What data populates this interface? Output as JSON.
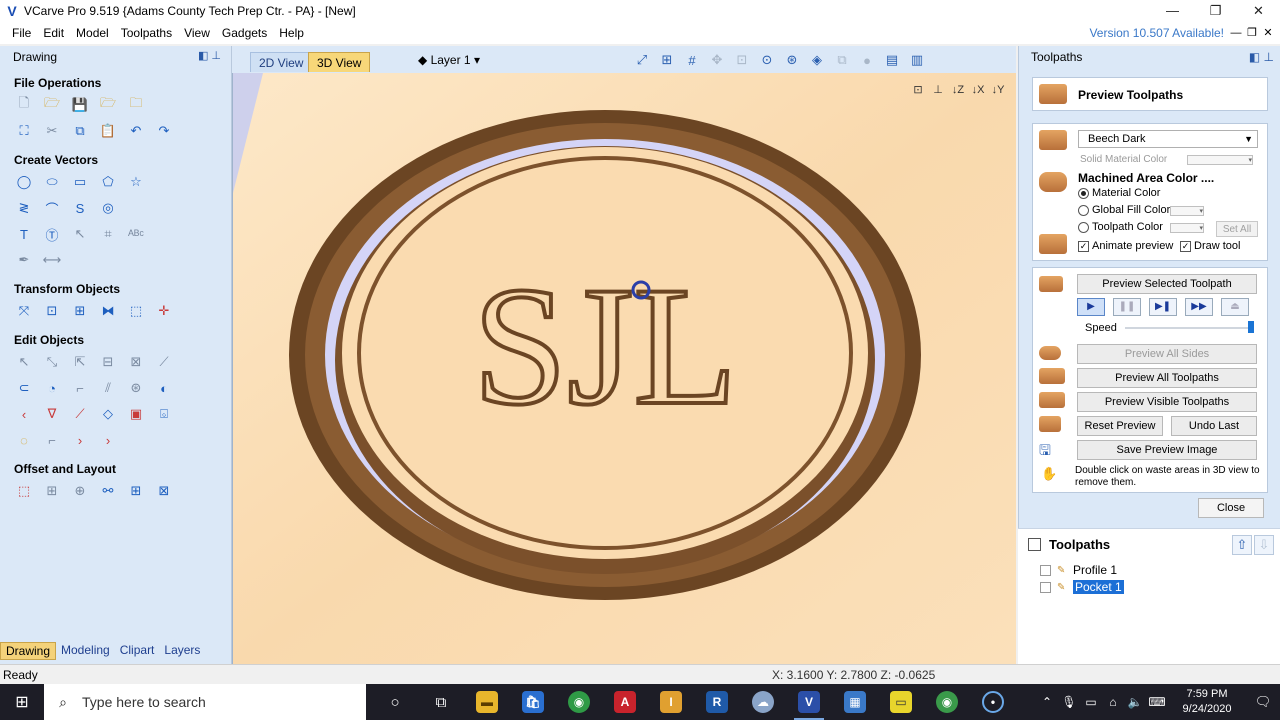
{
  "window": {
    "title": "VCarve Pro 9.519 {Adams County Tech Prep Ctr. - PA} - [New]",
    "controls": [
      "—",
      "❐",
      "✕"
    ]
  },
  "menu": {
    "items": [
      "File",
      "Edit",
      "Model",
      "Toolpaths",
      "View",
      "Gadgets",
      "Help"
    ],
    "version_notice": "Version 10.507 Available!"
  },
  "left_panel": {
    "title": "Drawing",
    "sections": {
      "file_operations": "File Operations",
      "create_vectors": "Create Vectors",
      "transform_objects": "Transform Objects",
      "edit_objects": "Edit Objects",
      "offset_layout": "Offset and Layout"
    },
    "tabs": [
      "Drawing",
      "Modeling",
      "Clipart",
      "Layers"
    ]
  },
  "view": {
    "tab_2d": "2D View",
    "tab_3d": "3D View",
    "layer": "Layer 1",
    "carving_text": "SJL"
  },
  "right_panel": {
    "title": "Toolpaths",
    "preview_title": "Preview Toolpaths",
    "material": "Beech Dark",
    "solid_material_color": "Solid Material Color",
    "machined_area_color": "Machined Area Color ....",
    "material_color": "Material Color",
    "global_fill_color": "Global Fill Color",
    "toolpath_color": "Toolpath Color",
    "set_all": "Set All",
    "animate_preview": "Animate preview",
    "draw_tool": "Draw tool",
    "preview_selected": "Preview Selected Toolpath",
    "speed": "Speed",
    "preview_all_sides": "Preview All Sides",
    "preview_all_toolpaths": "Preview All Toolpaths",
    "preview_visible_toolpaths": "Preview Visible Toolpaths",
    "reset_preview": "Reset Preview",
    "undo_last": "Undo Last",
    "save_preview_image": "Save Preview Image",
    "waste_note": "Double click on waste areas in 3D view to remove them.",
    "close": "Close",
    "list_title": "Toolpaths",
    "toolpaths": [
      "Profile 1",
      "Pocket 1"
    ]
  },
  "status": {
    "text": "Ready",
    "coords": "X: 3.1600 Y: 2.7800 Z: -0.0625"
  },
  "taskbar": {
    "search_placeholder": "Type here to search",
    "time": "7:59 PM",
    "date": "9/24/2020"
  },
  "colors": {
    "panel_bg": "#dbe8f7",
    "wood": "#fbe3c2",
    "active_tab": "#f7d779",
    "selection": "#1c6fd6"
  }
}
